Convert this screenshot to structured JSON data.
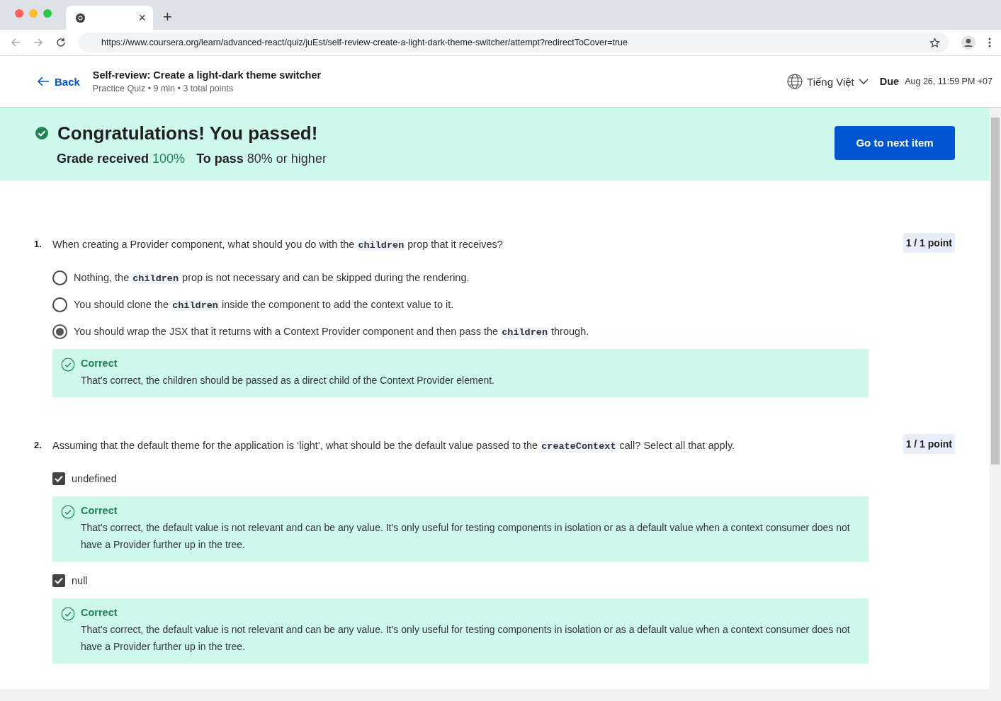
{
  "browser": {
    "tab": {
      "close": "×"
    },
    "new_tab": "+",
    "url": "https://www.coursera.org/learn/advanced-react/quiz/juEst/self-review-create-a-light-dark-theme-switcher/attempt?redirectToCover=true"
  },
  "header": {
    "back": "Back",
    "title": "Self-review: Create a light-dark theme switcher",
    "meta": "Practice Quiz • 9 min • 3 total points",
    "language": "Tiếng Việt",
    "due_label": "Due",
    "due": "Aug 26, 11:59 PM +07"
  },
  "banner": {
    "title": "Congratulations! You passed!",
    "grade_label": "Grade received",
    "grade": "100%",
    "pass_label": "To pass",
    "pass": "80% or higher",
    "button": "Go to next item"
  },
  "questions": [
    {
      "number": "1.",
      "points": "1 / 1 point",
      "parts": [
        {
          "kind": "text",
          "text": "When creating a Provider component, what should you do with the "
        },
        {
          "kind": "code",
          "text": "children"
        },
        {
          "kind": "text",
          "text": " prop that it receives?"
        }
      ],
      "options": [
        {
          "kind": "radio",
          "selected": false,
          "parts": [
            {
              "kind": "text",
              "text": "Nothing, the "
            },
            {
              "kind": "code",
              "text": "children"
            },
            {
              "kind": "text",
              "text": " prop is not necessary and can be skipped during the rendering."
            }
          ]
        },
        {
          "kind": "radio",
          "selected": false,
          "parts": [
            {
              "kind": "text",
              "text": "You should clone the "
            },
            {
              "kind": "code",
              "text": "children"
            },
            {
              "kind": "text",
              "text": " inside the component to add the context value to it."
            }
          ]
        },
        {
          "kind": "radio",
          "selected": true,
          "parts": [
            {
              "kind": "text",
              "text": "You should wrap the JSX that it returns with a Context Provider component and then pass the "
            },
            {
              "kind": "code",
              "text": "children"
            },
            {
              "kind": "text",
              "text": " through."
            }
          ],
          "feedback": {
            "label": "Correct",
            "text": "That's correct, the children should be passed as a direct child of the Context Provider element."
          }
        }
      ]
    },
    {
      "number": "2.",
      "points": "1 / 1 point",
      "parts": [
        {
          "kind": "text",
          "text": "Assuming that the default theme for the application is ‘light’, what should be the default value passed to the "
        },
        {
          "kind": "code",
          "text": "createContext"
        },
        {
          "kind": "text",
          "text": " call? Select all that apply."
        }
      ],
      "options": [
        {
          "kind": "checkbox",
          "selected": true,
          "parts": [
            {
              "kind": "text",
              "text": "undefined"
            }
          ],
          "feedback": {
            "label": "Correct",
            "text": "That's correct, the default value is not relevant and can be any value. It’s only useful for testing components in isolation or as a default value when a context consumer does not have a Provider further up in the tree."
          }
        },
        {
          "kind": "checkbox",
          "selected": true,
          "parts": [
            {
              "kind": "text",
              "text": "null"
            }
          ],
          "feedback": {
            "label": "Correct",
            "text": "That's correct, the default value is not relevant and can be any value. It’s only useful for testing components in isolation or as a default value when a context consumer does not have a Provider further up in the tree."
          }
        }
      ]
    }
  ]
}
